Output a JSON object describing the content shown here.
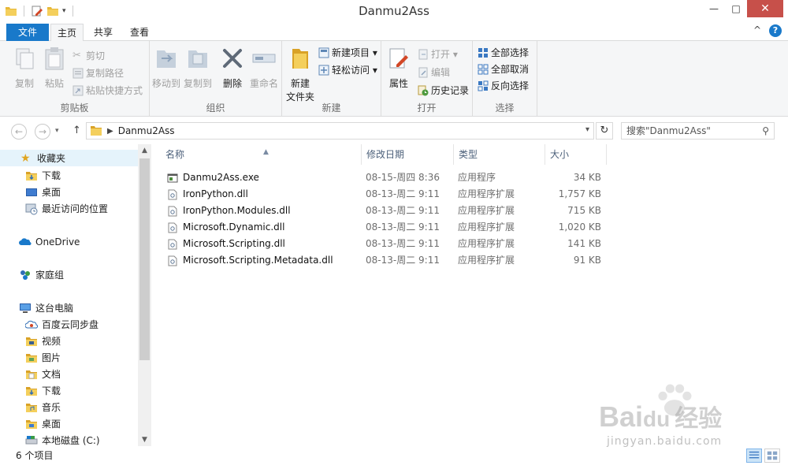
{
  "window": {
    "title": "Danmu2Ass",
    "minimize": "—",
    "maximize": "□",
    "close": "✕"
  },
  "ribbon_tabs": {
    "file": "文件",
    "home": "主页",
    "share": "共享",
    "view": "查看"
  },
  "help": {
    "expand": "^",
    "question": "?"
  },
  "ribbon": {
    "clipboard": {
      "label": "剪贴板",
      "copy": "复制",
      "paste": "粘贴",
      "cut": "剪切",
      "copy_path": "复制路径",
      "paste_shortcut": "粘贴快捷方式"
    },
    "organize": {
      "label": "组织",
      "move_to": "移动到",
      "copy_to": "复制到",
      "delete": "删除",
      "rename": "重命名"
    },
    "new": {
      "label": "新建",
      "new_folder_line1": "新建",
      "new_folder_line2": "文件夹",
      "new_item": "新建项目 ▾",
      "easy_access": "轻松访问 ▾"
    },
    "open": {
      "label": "打开",
      "properties": "属性",
      "open": "打开 ▾",
      "edit": "编辑",
      "history": "历史记录"
    },
    "select": {
      "label": "选择",
      "select_all": "全部选择",
      "select_none": "全部取消",
      "invert": "反向选择"
    }
  },
  "address": {
    "back": "←",
    "forward": "→",
    "up": "↑",
    "path": "Danmu2Ass",
    "refresh": "↻",
    "search_placeholder": "搜索\"Danmu2Ass\""
  },
  "nav": {
    "items": [
      {
        "label": "收藏夹"
      },
      {
        "label": "下载"
      },
      {
        "label": "桌面"
      },
      {
        "label": "最近访问的位置"
      },
      {
        "label": "OneDrive"
      },
      {
        "label": "家庭组"
      },
      {
        "label": "这台电脑"
      },
      {
        "label": "百度云同步盘"
      },
      {
        "label": "视频"
      },
      {
        "label": "图片"
      },
      {
        "label": "文档"
      },
      {
        "label": "下载"
      },
      {
        "label": "音乐"
      },
      {
        "label": "桌面"
      },
      {
        "label": "本地磁盘 (C:)"
      }
    ]
  },
  "columns": {
    "name": "名称",
    "modified": "修改日期",
    "type": "类型",
    "size": "大小"
  },
  "files": [
    {
      "name": "Danmu2Ass.exe",
      "date": "08-15-周四 8:36",
      "type": "应用程序",
      "size": "34 KB"
    },
    {
      "name": "IronPython.dll",
      "date": "08-13-周二 9:11",
      "type": "应用程序扩展",
      "size": "1,757 KB"
    },
    {
      "name": "IronPython.Modules.dll",
      "date": "08-13-周二 9:11",
      "type": "应用程序扩展",
      "size": "715 KB"
    },
    {
      "name": "Microsoft.Dynamic.dll",
      "date": "08-13-周二 9:11",
      "type": "应用程序扩展",
      "size": "1,020 KB"
    },
    {
      "name": "Microsoft.Scripting.dll",
      "date": "08-13-周二 9:11",
      "type": "应用程序扩展",
      "size": "141 KB"
    },
    {
      "name": "Microsoft.Scripting.Metadata.dll",
      "date": "08-13-周二 9:11",
      "type": "应用程序扩展",
      "size": "91 KB"
    }
  ],
  "status": {
    "count": "6 个项目"
  },
  "watermark": {
    "brand": "Bai",
    "brand2": "du",
    "brand_cn": "经验",
    "url": "jingyan.baidu.com"
  },
  "colors": {
    "accent": "#1979ca",
    "close": "#c7504a",
    "folder": "#e8b838"
  }
}
